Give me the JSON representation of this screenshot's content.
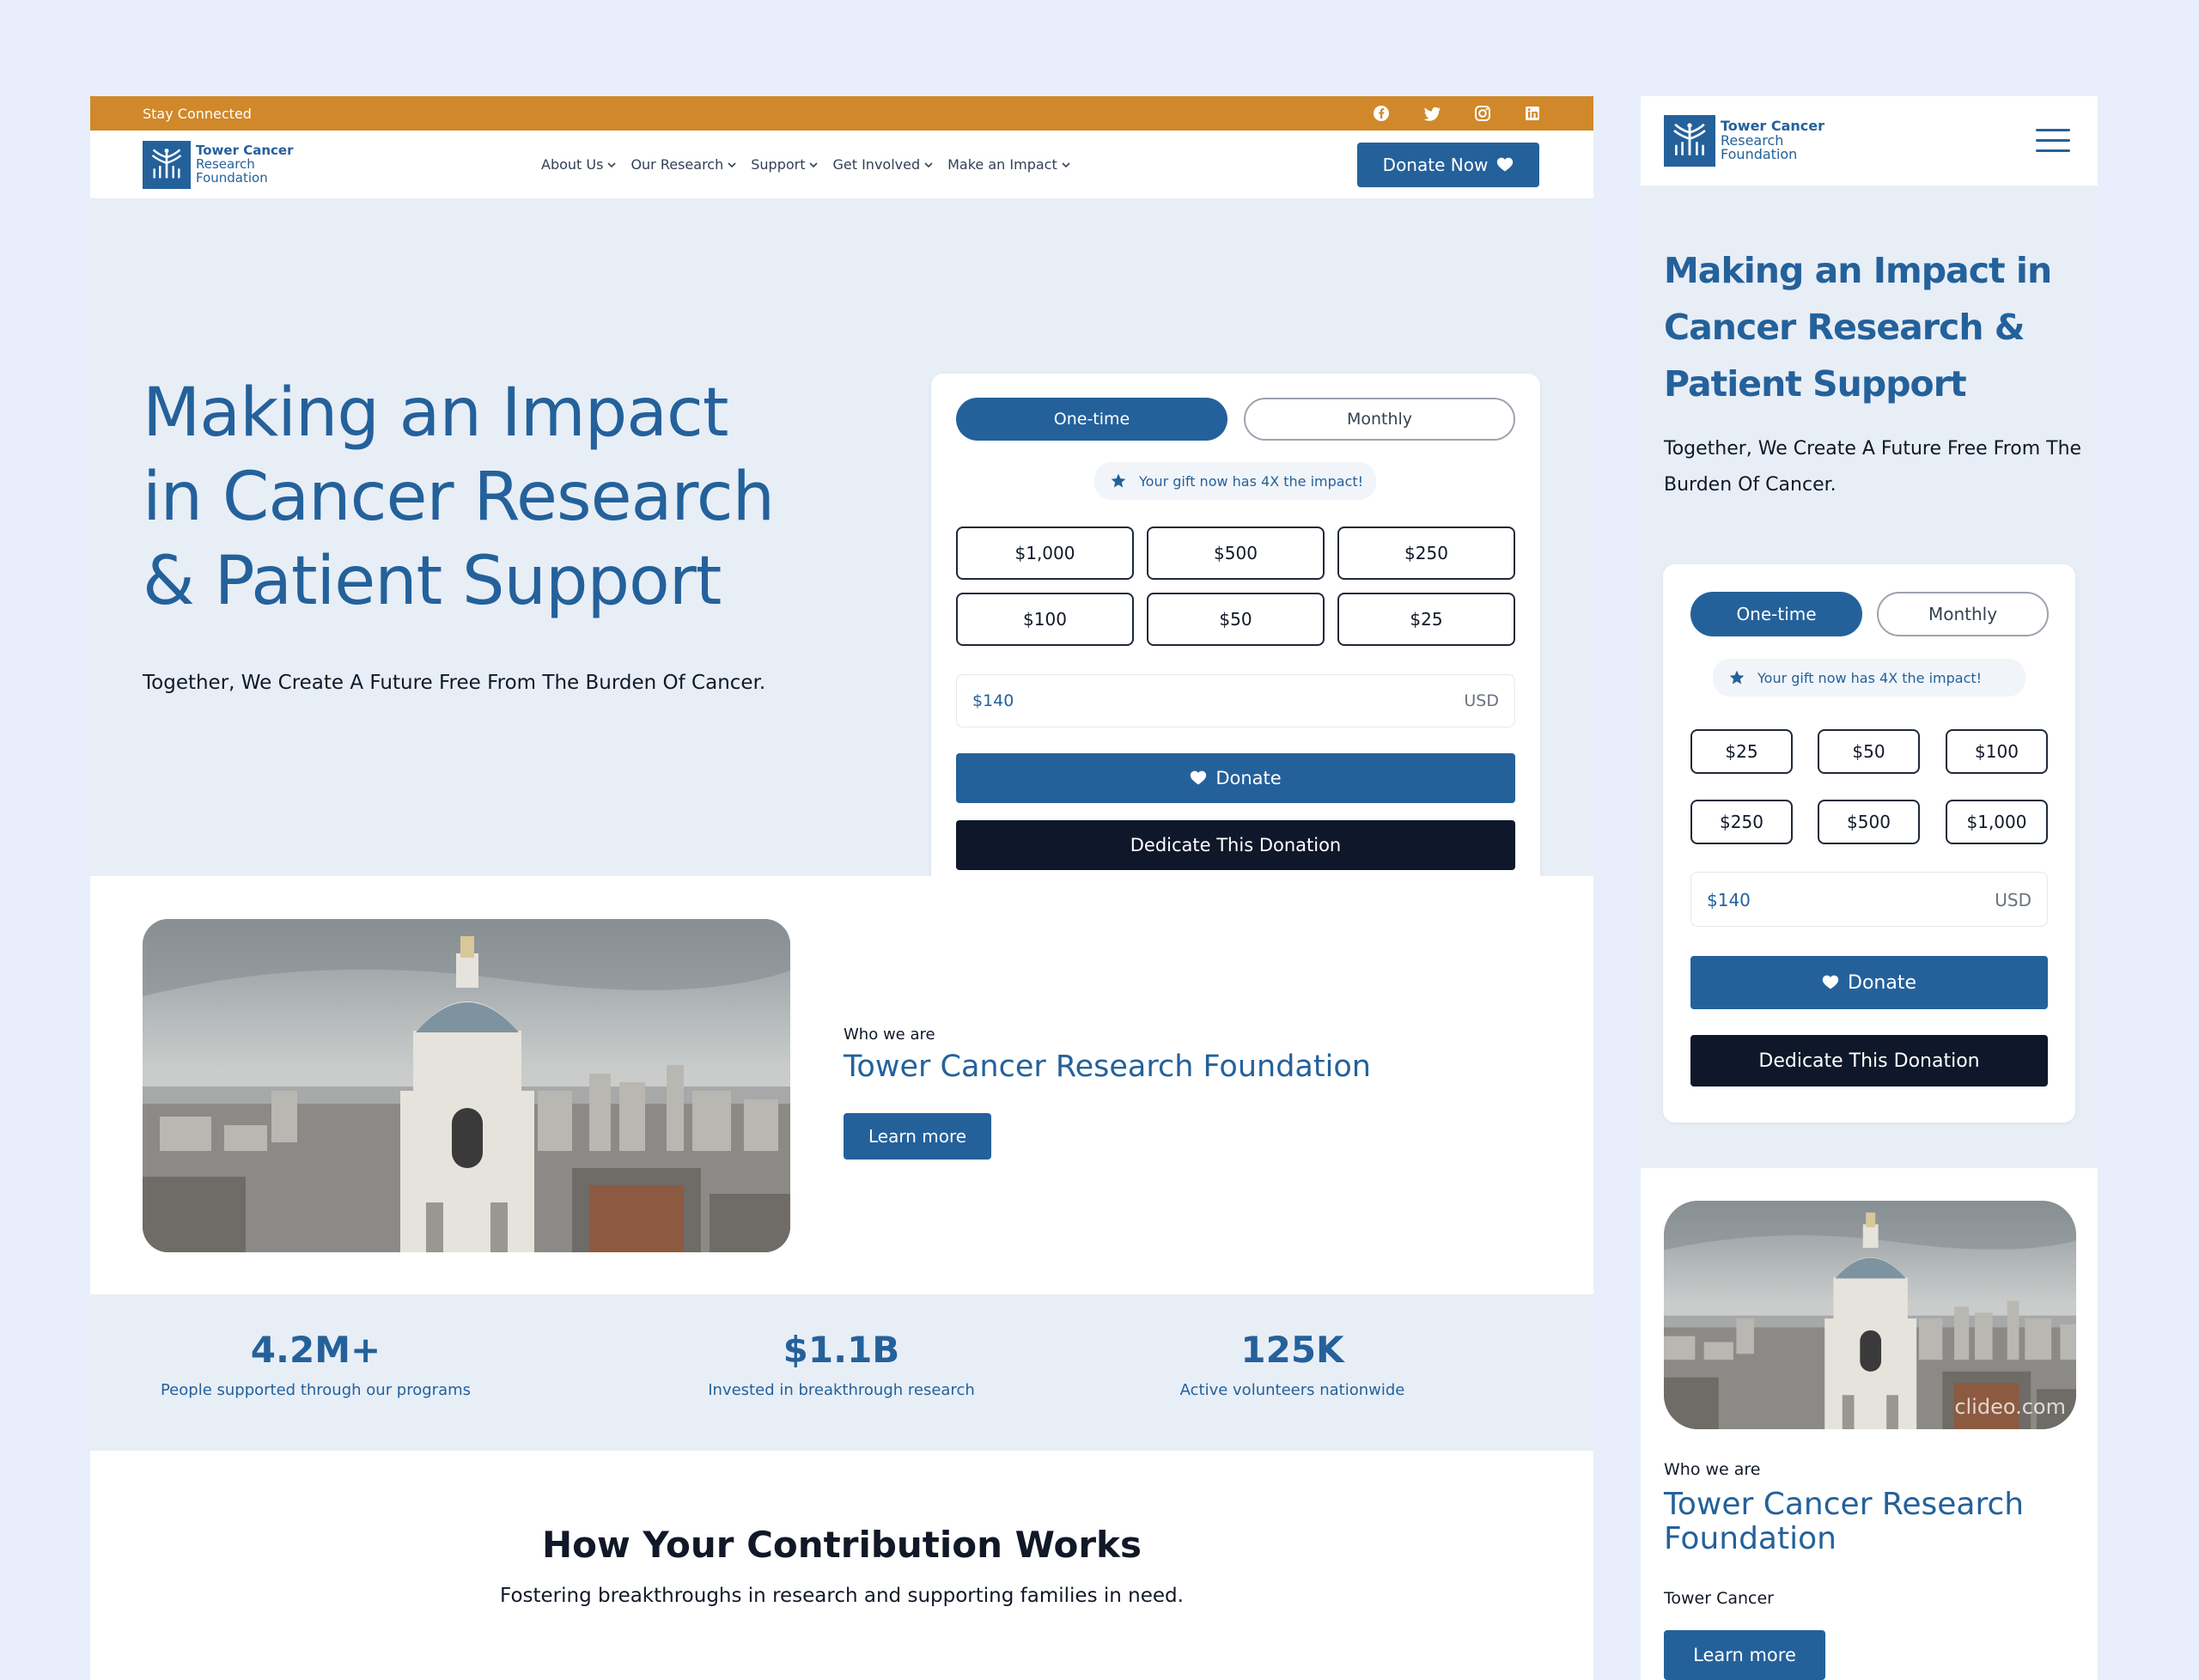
{
  "colors": {
    "brand": "#24619b",
    "accent": "#d0882a",
    "dark": "#0f172a",
    "background": "#e8eefb",
    "section": "#e8eef6"
  },
  "brand": {
    "line1": "Tower Cancer",
    "line2": "Research",
    "line3": "Foundation"
  },
  "topbar": {
    "text": "Stay Connected",
    "social_icons": [
      "facebook-icon",
      "twitter-icon",
      "instagram-icon",
      "linkedin-icon"
    ]
  },
  "nav": {
    "items": [
      {
        "label": "About Us"
      },
      {
        "label": "Our Research"
      },
      {
        "label": "Support"
      },
      {
        "label": "Get Involved"
      },
      {
        "label": "Make an Impact"
      }
    ],
    "donate_now": "Donate Now"
  },
  "hero": {
    "title": "Making an Impact in Cancer Research & Patient Support",
    "subtitle": "Together, We Create A Future Free From The Burden Of Cancer."
  },
  "donation": {
    "one_time": "One-time",
    "monthly": "Monthly",
    "gift_note": "Your gift now has 4X the impact!",
    "amounts_desktop": [
      "$1,000",
      "$500",
      "$250",
      "$100",
      "$50",
      "$25"
    ],
    "amounts_mobile": [
      "$25",
      "$50",
      "$100",
      "$250",
      "$500",
      "$1,000"
    ],
    "custom_value": "$140",
    "currency": "USD",
    "donate": "Donate",
    "dedicate": "Dedicate This Donation"
  },
  "about": {
    "eyebrow": "Who we are",
    "title": "Tower Cancer Research Foundation",
    "learn_more": "Learn more",
    "mobile_text": "Tower Cancer",
    "watermark": "clideo.com"
  },
  "stats": [
    {
      "value": "4.2M+",
      "label": "People supported through our programs"
    },
    {
      "value": "$1.1B",
      "label": "Invested in breakthrough research"
    },
    {
      "value": "125K",
      "label": "Active volunteers nationwide"
    }
  ],
  "how": {
    "title": "How Your Contribution Works",
    "subtitle": "Fostering breakthroughs in research and supporting families in need."
  }
}
